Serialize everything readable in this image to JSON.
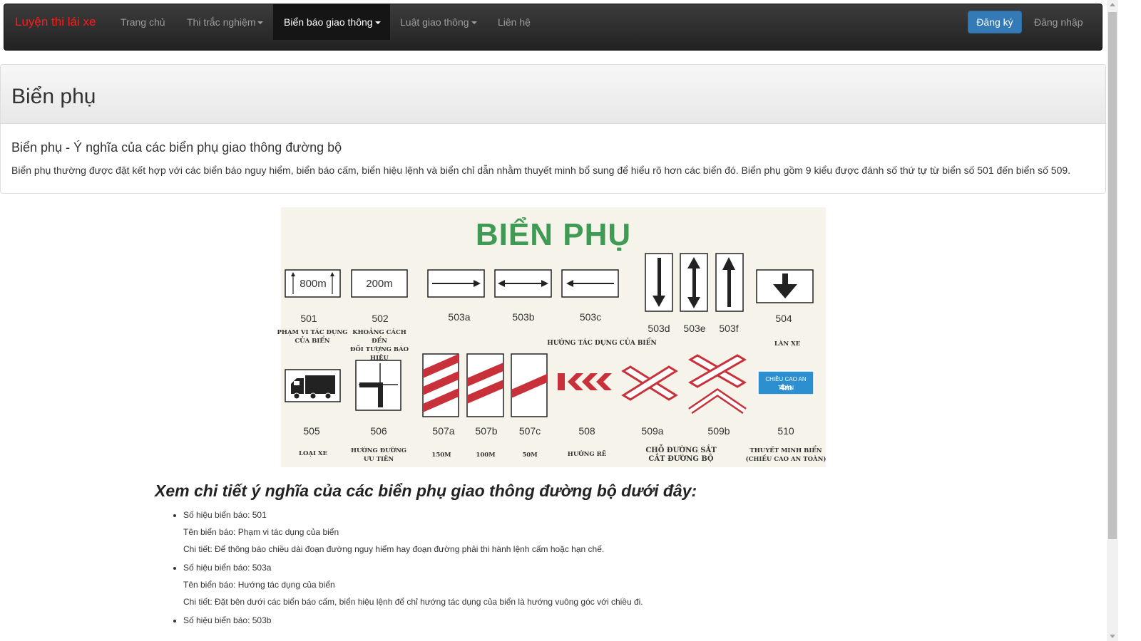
{
  "navbar": {
    "brand": "Luyện thi lái xe",
    "items": [
      {
        "label": "Trang chủ",
        "dropdown": false,
        "active": false
      },
      {
        "label": "Thi trắc nghiệm",
        "dropdown": true,
        "active": false
      },
      {
        "label": "Biển báo giao thông",
        "dropdown": true,
        "active": true
      },
      {
        "label": "Luật giao thông",
        "dropdown": true,
        "active": false
      },
      {
        "label": "Liên hệ",
        "dropdown": false,
        "active": false
      }
    ],
    "register_label": "Đăng ký",
    "login_label": "Đăng nhập",
    "brand_color": "#ff1a1a",
    "accent_color": "#337ab7"
  },
  "page": {
    "title": "Biển phụ",
    "subtitle": "Biển phụ - Ý nghĩa của các biển phụ giao thông đường bộ",
    "intro": "Biển phụ thường được đặt kết hợp với các biển báo nguy hiểm, biển báo cấm, biển hiệu lệnh và biển chỉ dẫn nhằm thuyết minh bổ sung để hiểu rõ hơn các biển đó. Biển phụ gồm 9 kiểu được đánh số thứ tự từ biển số 501 đến biển số 509."
  },
  "sign_image": {
    "title": "BIỂN PHỤ",
    "title_color": "#3f9a55",
    "sign_red": "#c8313a",
    "sign_blue": "#2c8fd0",
    "row1": {
      "s501_text": "800m",
      "s502_text": "200m",
      "numbers": [
        "501",
        "502",
        "503a",
        "503b",
        "503c",
        "503d",
        "503e",
        "503f",
        "504"
      ],
      "cap_501": [
        "PHẠM VI TÁC DỤNG",
        "CỦA BIỂN"
      ],
      "cap_502": [
        "KHOẢNG CÁCH ĐẾN",
        "ĐỐI TƯỢNG BÁO HIỆU"
      ],
      "cap_503": "HƯỚNG TÁC DỤNG CỦA BIỂN",
      "cap_504": "LÀN XE"
    },
    "row2": {
      "numbers": [
        "505",
        "506",
        "507a",
        "507b",
        "507c",
        "508",
        "509a",
        "509b",
        "510"
      ],
      "cap_505": "LOẠI XE",
      "cap_506": [
        "HƯỚNG ĐƯỜNG",
        "ƯU TIÊN"
      ],
      "cap_507a": "150M",
      "cap_507b": "100M",
      "cap_507c": "50M",
      "cap_508": "HƯỚNG RẼ",
      "cap_509": [
        "CHỖ ĐƯỜNG SẮT",
        "CẮT ĐƯỜNG BỘ"
      ],
      "cap_510": [
        "THUYẾT MINH BIỂN",
        "(CHIỀU CAO AN TOÀN)"
      ],
      "s510_text1": "CHIỀU CAO AN TOÀN",
      "s510_text2": "4m"
    }
  },
  "details": {
    "heading": "Xem chi tiết ý nghĩa của các biển phụ giao thông đường bộ dưới đây:",
    "items": [
      {
        "number": "Số hiệu biển báo: 501",
        "name": "Tên biển báo: Phạm vi tác dụng của biển",
        "detail": "Chi tiết: Để thông báo chiều dài đoạn đường nguy hiểm hay đoạn đường phải thi hành lệnh cấm hoặc hạn chế."
      },
      {
        "number": "Số hiệu biển báo: 503a",
        "name": "Tên biển báo: Hướng tác dụng của biển",
        "detail": "Chi tiết: Đặt bên dưới các biển báo cấm, biển hiệu lệnh để chỉ hướng tác dụng của biển là hướng vuông góc với chiều đi."
      },
      {
        "number": "Số hiệu biển báo: 503b"
      }
    ]
  }
}
